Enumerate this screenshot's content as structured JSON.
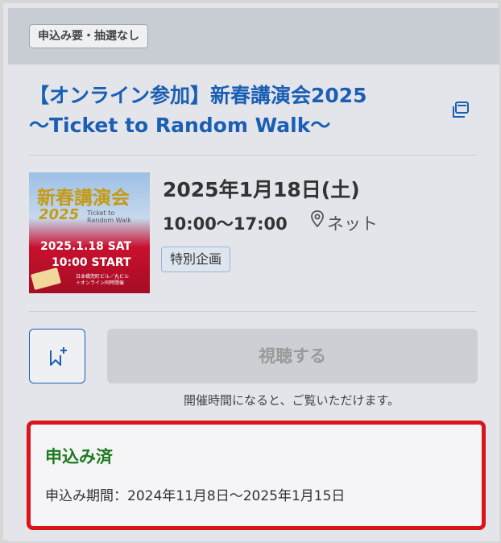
{
  "badge": {
    "text": "申込み要・抽選なし"
  },
  "event": {
    "title_line1": "【オンライン参加】新春講演会2025",
    "title_line2": "〜Ticket to Random Walk〜",
    "date": "2025年1月18日(土)",
    "time": "10:00〜17:00",
    "location": "ネット",
    "category_tag": "特別企画"
  },
  "thumbnail": {
    "title": "新春講演会",
    "year": "2025",
    "subtitle_line1": "Ticket to",
    "subtitle_line2": "Random Walk",
    "date_text": "2025.1.18 SAT",
    "start_text": "10:00 START",
    "venue_line1": "日本橋兜町ビル／丸ビル",
    "venue_line2": "＋オンライン同時開催"
  },
  "actions": {
    "watch_label": "視聴する",
    "note": "開催時間になると、ご覧いただけます。"
  },
  "status": {
    "label": "申込み済",
    "period": "申込み期間：2024年11月8日〜2025年1月15日"
  },
  "icons": {
    "external": "open-in-new-icon",
    "bookmark": "bookmark-add-icon",
    "location": "map-pin-icon"
  },
  "colors": {
    "title_blue": "#1a5fb4",
    "status_green": "#1d7a1d",
    "highlight_red": "#d9141b"
  }
}
